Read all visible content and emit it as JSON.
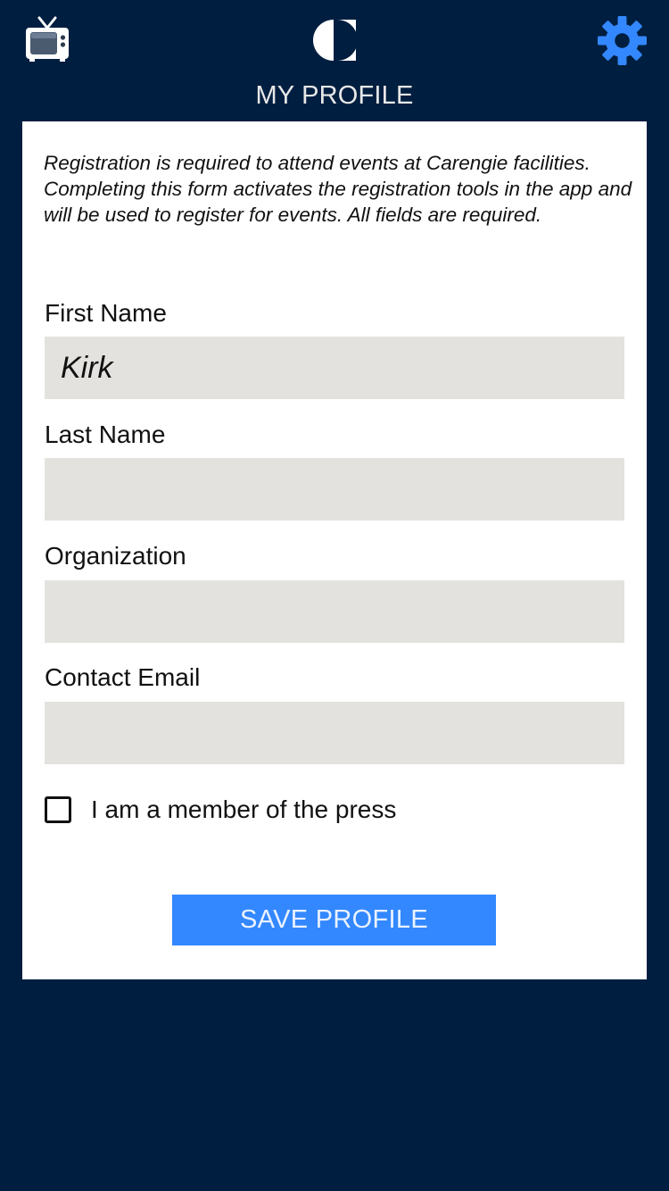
{
  "header": {
    "title": "MY PROFILE",
    "left_icon": "tv-icon",
    "center_icon": "half-circle-logo-icon",
    "right_icon": "gear-icon"
  },
  "form": {
    "intro": "Registration is required to attend events at Carengie facilities. Completing this form activates the registration tools in the app and will be used to register for events. All fields are required.",
    "fields": [
      {
        "label": "First Name",
        "value": "Kirk"
      },
      {
        "label": "Last Name",
        "value": ""
      },
      {
        "label": "Organization",
        "value": ""
      },
      {
        "label": "Contact Email",
        "value": ""
      }
    ],
    "press_checkbox": {
      "label": "I am a member of the press",
      "checked": false
    },
    "save_label": "SAVE PROFILE"
  },
  "colors": {
    "background": "#001e40",
    "accent": "#3388ff",
    "input_fill": "#e3e2de",
    "card": "#ffffff"
  }
}
